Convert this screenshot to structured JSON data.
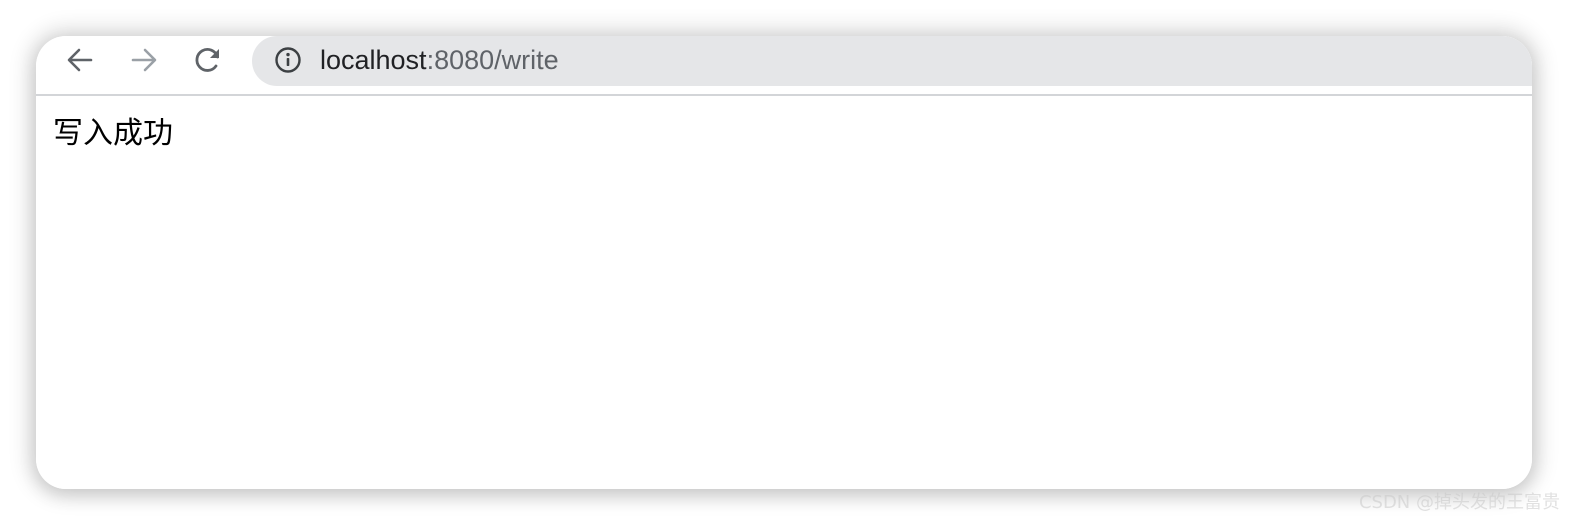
{
  "browser": {
    "address_bar": {
      "url_host": "localhost",
      "url_rest": ":8080/write",
      "icons": {
        "site_info": "info-circle-icon"
      }
    },
    "nav": {
      "back_icon": "arrow-left-icon",
      "forward_icon": "arrow-right-icon",
      "reload_icon": "reload-icon"
    }
  },
  "page": {
    "message": "写入成功"
  },
  "watermark": "CSDN @掉头发的王富贵",
  "colors": {
    "omnibox_bg": "#e5e6e8",
    "icon_active": "#5f6368",
    "icon_disabled": "#9aa0a6",
    "text": "#202124"
  }
}
